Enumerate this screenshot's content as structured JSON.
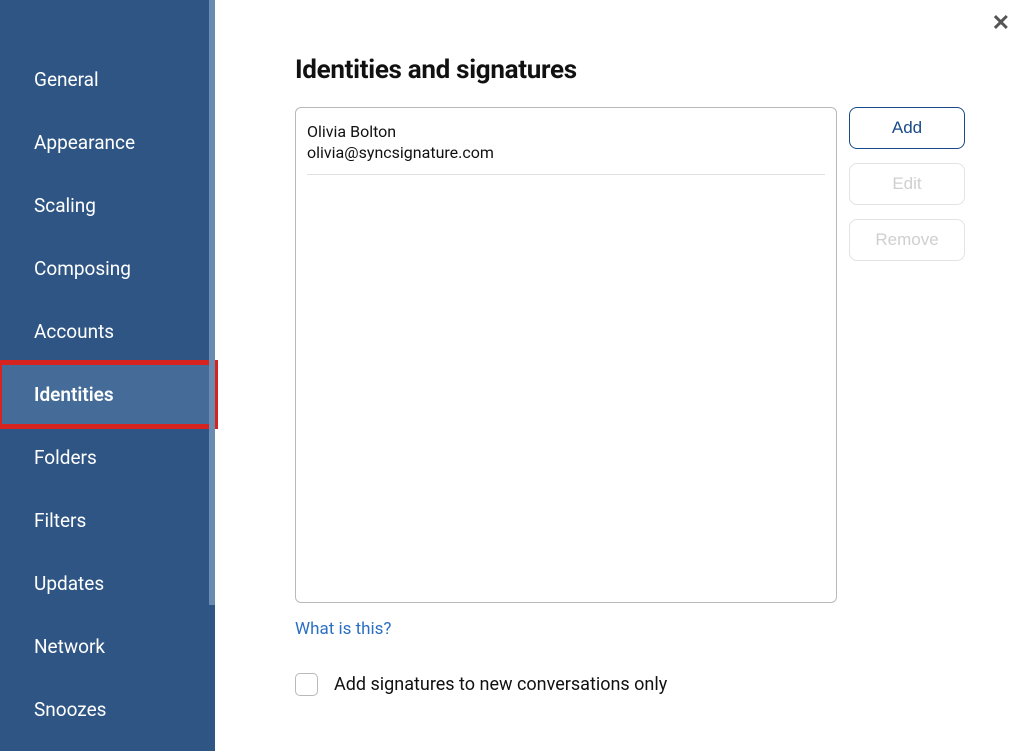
{
  "sidebar": {
    "items": [
      {
        "label": "General",
        "active": false,
        "highlighted": false
      },
      {
        "label": "Appearance",
        "active": false,
        "highlighted": false
      },
      {
        "label": "Scaling",
        "active": false,
        "highlighted": false
      },
      {
        "label": "Composing",
        "active": false,
        "highlighted": false
      },
      {
        "label": "Accounts",
        "active": false,
        "highlighted": false
      },
      {
        "label": "Identities",
        "active": true,
        "highlighted": true
      },
      {
        "label": "Folders",
        "active": false,
        "highlighted": false
      },
      {
        "label": "Filters",
        "active": false,
        "highlighted": false
      },
      {
        "label": "Updates",
        "active": false,
        "highlighted": false
      },
      {
        "label": "Network",
        "active": false,
        "highlighted": false
      },
      {
        "label": "Snoozes",
        "active": false,
        "highlighted": false
      }
    ]
  },
  "page": {
    "title": "Identities and signatures",
    "identities": [
      {
        "name": "Olivia Bolton",
        "email": "olivia@syncsignature.com"
      }
    ],
    "buttons": {
      "add": "Add",
      "edit": "Edit",
      "remove": "Remove"
    },
    "help_link": "What is this?",
    "checkbox_label": "Add signatures to new conversations only",
    "checkbox_checked": false
  }
}
